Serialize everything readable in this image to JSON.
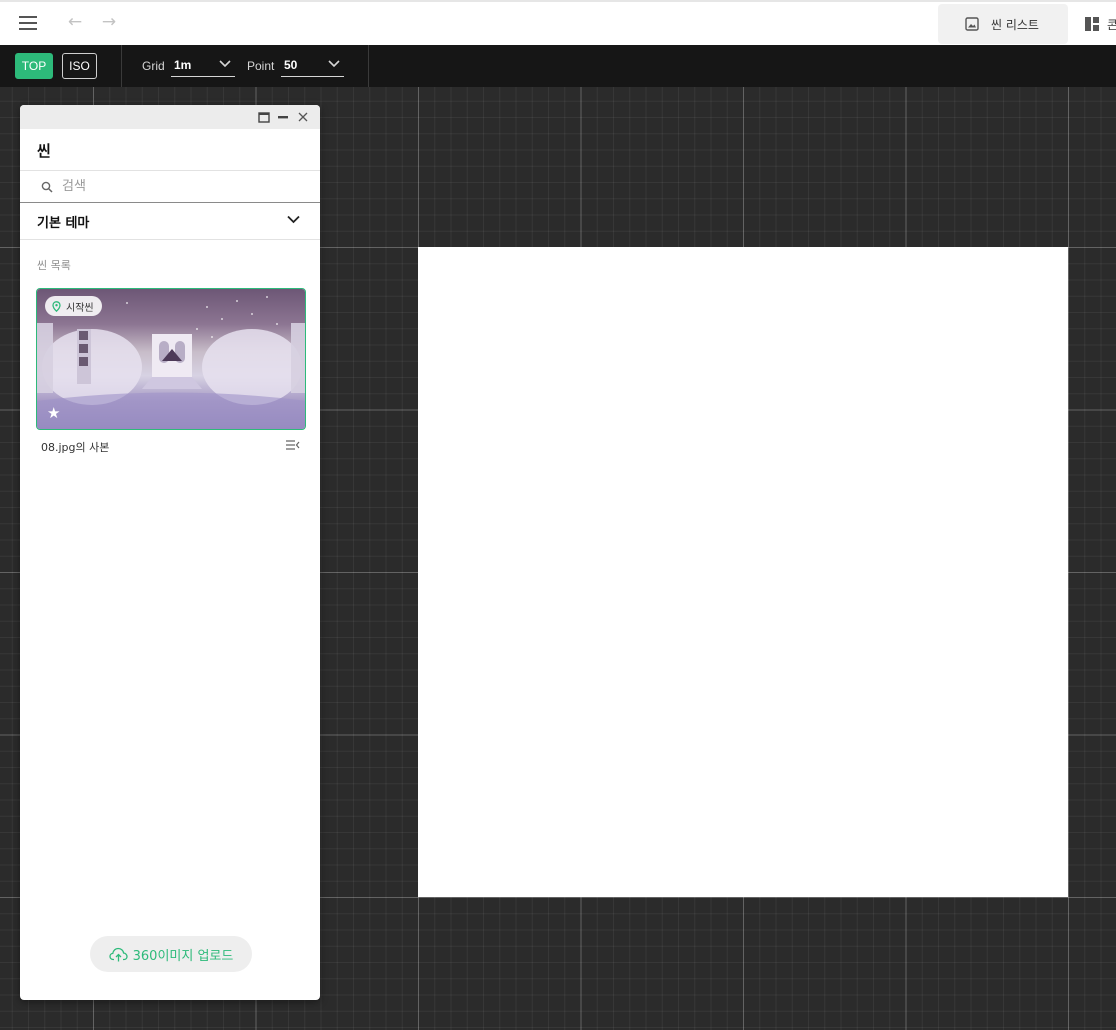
{
  "topbar": {
    "menu_icon": "hamburger-menu-icon",
    "back_icon": "arrow-left-icon",
    "forward_icon": "arrow-right-icon",
    "scene_list_label": "씬 리스트",
    "layout_label": "콘"
  },
  "toolbar": {
    "mode_top": "TOP",
    "mode_iso": "ISO",
    "grid_label": "Grid",
    "grid_value": "1m",
    "point_label": "Point",
    "point_value": "50"
  },
  "panel": {
    "title": "씬",
    "search_placeholder": "검색",
    "theme_label": "기본 테마",
    "section_label": "씬 목록",
    "scenes": [
      {
        "badge": "시작씬",
        "name": "08.jpg의 사본",
        "starred": true
      }
    ],
    "upload_label": "360이미지 업로드"
  },
  "colors": {
    "accent": "#2dba7a",
    "toolbar_bg": "#161616",
    "canvas_bg": "#2b2b2b"
  }
}
